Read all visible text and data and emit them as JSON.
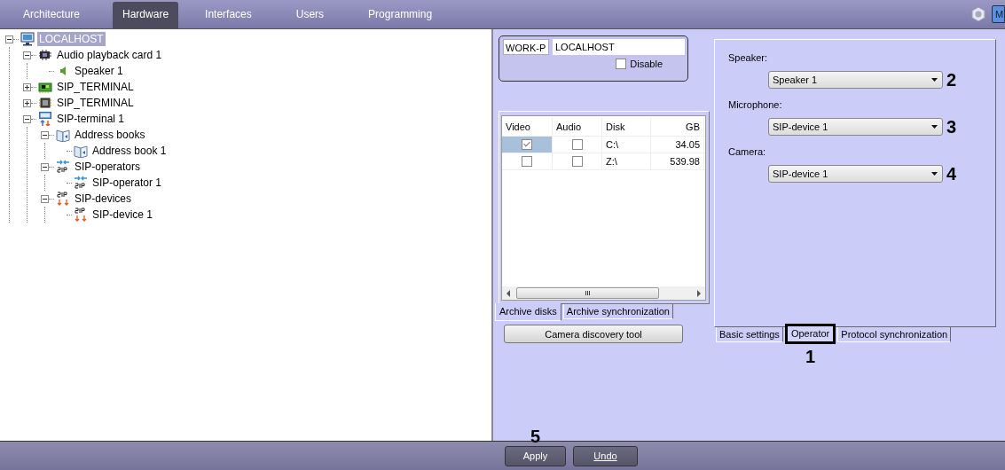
{
  "nav_tabs": [
    {
      "label": "Architecture",
      "selected": false
    },
    {
      "label": "Hardware",
      "selected": true
    },
    {
      "label": "Interfaces",
      "selected": false
    },
    {
      "label": "Users",
      "selected": false
    },
    {
      "label": "Programming",
      "selected": false
    }
  ],
  "header_badge": "M",
  "tree": [
    {
      "label": "LOCALHOST",
      "kind": "computer",
      "selected": true,
      "expanded": true,
      "children": [
        {
          "label": "Audio playback card 1",
          "kind": "audio-card",
          "selected": false,
          "expanded": true,
          "children": [
            {
              "label": "Speaker 1",
              "kind": "speaker",
              "selected": false
            }
          ]
        },
        {
          "label": "SIP_TERMINAL",
          "kind": "board",
          "selected": false,
          "expanded": false
        },
        {
          "label": "SIP_TERMINAL",
          "kind": "chip",
          "selected": false,
          "expanded": false
        },
        {
          "label": "SIP-terminal 1",
          "kind": "sip-terminal",
          "selected": false,
          "expanded": true,
          "children": [
            {
              "label": "Address books",
              "kind": "address-book",
              "selected": false,
              "expanded": true,
              "children": [
                {
                  "label": "Address book 1",
                  "kind": "address-book",
                  "selected": false
                }
              ]
            },
            {
              "label": "SIP-operators",
              "kind": "sip-operator",
              "selected": false,
              "expanded": true,
              "children": [
                {
                  "label": "SIP-operator 1",
                  "kind": "sip-operator",
                  "selected": false
                }
              ]
            },
            {
              "label": "SIP-devices",
              "kind": "sip-device",
              "selected": false,
              "expanded": true,
              "children": [
                {
                  "label": "SIP-device 1",
                  "kind": "sip-device",
                  "selected": false
                }
              ]
            }
          ]
        }
      ]
    }
  ],
  "workplace": {
    "id": "WORK-P",
    "name": "LOCALHOST",
    "disable": {
      "label": "Disable",
      "checked": false
    }
  },
  "disks": {
    "columns": [
      "Video",
      "Audio",
      "Disk",
      "GB"
    ],
    "rows": [
      {
        "video": true,
        "audio": false,
        "disk": "C:\\",
        "gb": "34.05",
        "selected": true
      },
      {
        "video": false,
        "audio": false,
        "disk": "Z:\\",
        "gb": "539.98",
        "selected": false
      }
    ],
    "scroll_glyph": "III"
  },
  "left_tabs": [
    {
      "label": "Archive disks",
      "selected": true
    },
    {
      "label": "Archive synchronization",
      "selected": false
    }
  ],
  "discovery_button": "Camera discovery tool",
  "operator": {
    "fields": [
      {
        "label": "Speaker:",
        "value": "Speaker 1",
        "annotation": "2"
      },
      {
        "label": "Microphone:",
        "value": "SIP-device 1",
        "annotation": "3"
      },
      {
        "label": "Camera:",
        "value": "SIP-device 1",
        "annotation": "4"
      }
    ],
    "tabs": [
      {
        "label": "Basic settings",
        "selected": false
      },
      {
        "label": "Operator",
        "selected": true,
        "annotation": "1"
      },
      {
        "label": "Protocol synchronization",
        "selected": false
      }
    ]
  },
  "footer_buttons": [
    {
      "label": "Apply",
      "annotation": "5",
      "underline_first": false
    },
    {
      "label": "Undo",
      "underline_first": true
    }
  ]
}
